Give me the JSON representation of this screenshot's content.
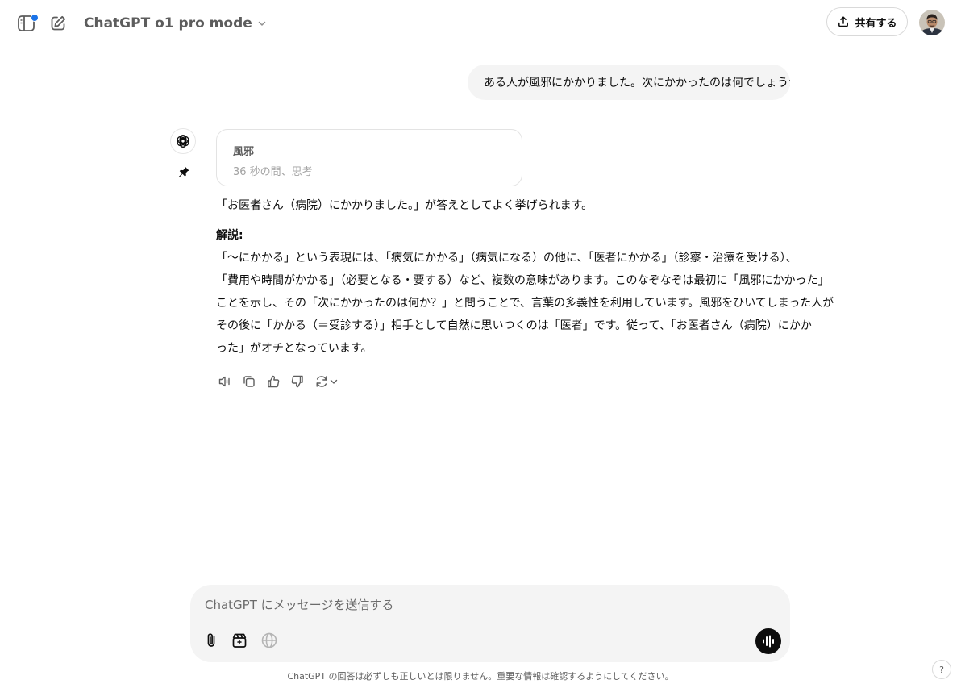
{
  "header": {
    "model_name": "ChatGPT o1 pro mode",
    "share_label": "共有する",
    "icons": {
      "sidebar": "sidebar-icon",
      "new_chat": "new-chat-icon",
      "model_chevron": "chevron-down-icon",
      "share": "upload-icon"
    },
    "notification_dot_color": "#1a73e8"
  },
  "conversation": {
    "user_message": "ある人が風邪にかかりました。次にかかったのは何でしょうか",
    "thinking": {
      "title": "風邪",
      "duration": "36 秒の間、思考"
    },
    "answer": "「お医者さん（病院）にかかりました。」が答えとしてよく挙げられます。",
    "explanation_heading": "解説:",
    "explanation_lines": [
      "「〜にかかる」という表現には、「病気にかかる」（病気になる）の他に、「医者にかかる」（診察・治療を受ける）、",
      "「費用や時間がかかる」（必要となる・要する）など、複数の意味があります。このなぞなぞは最初に「風邪にかかった」",
      "ことを示し、その「次にかかったのは何か？」と問うことで、言葉の多義性を利用しています。風邪をひいてしまった人が",
      "その後に「かかる（＝受診する）」相手として自然に思いつくのは「医者」です。従って、「お医者さん（病院）にかか",
      "った」がオチとなっています。"
    ],
    "action_icons": [
      "speaker-icon",
      "copy-icon",
      "thumbs-up-icon",
      "thumbs-down-icon",
      "regenerate-icon"
    ]
  },
  "composer": {
    "placeholder": "ChatGPT にメッセージを送信する",
    "value": "",
    "icons": [
      "paperclip-icon",
      "tools-icon",
      "globe-icon",
      "voice-icon"
    ]
  },
  "footer": {
    "disclaimer": "ChatGPT の回答は必ずしも正しいとは限りません。重要な情報は確認するようにしてください。",
    "help": "?"
  }
}
